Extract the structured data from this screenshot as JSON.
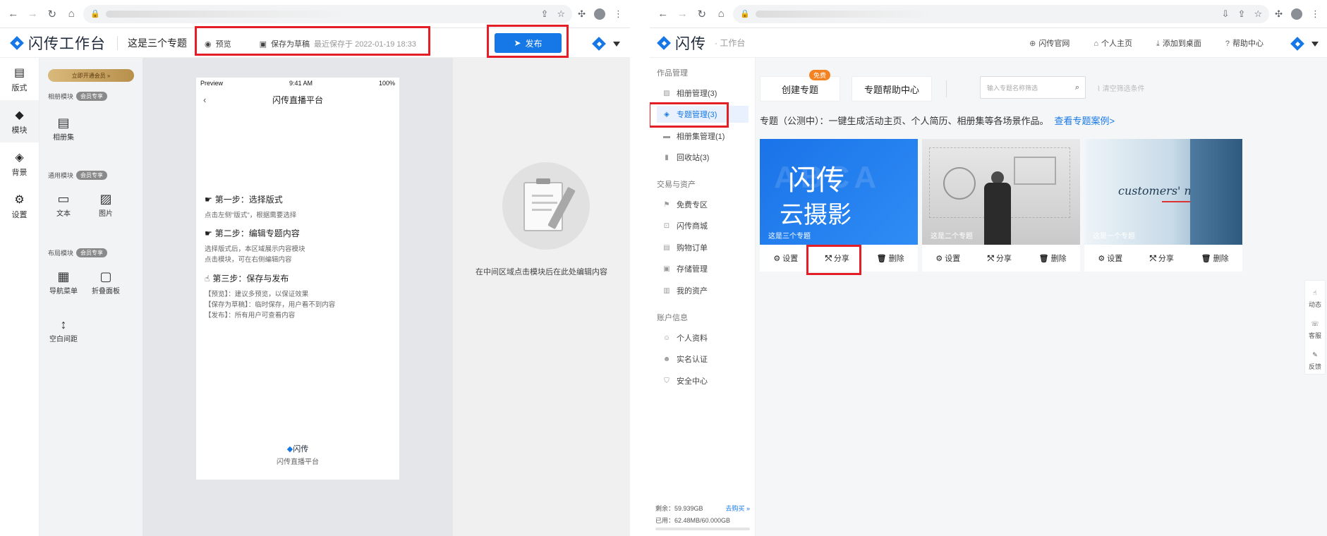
{
  "editor": {
    "logo_text": "闪传工作台",
    "page_title": "这是三个专题",
    "preview_label": "预览",
    "save_draft_label": "保存为草稿",
    "last_saved": "最近保存于 2022-01-19 18:33",
    "publish_label": "发布",
    "rail": [
      {
        "icon": "▤",
        "label": "版式"
      },
      {
        "icon": "◆",
        "label": "模块"
      },
      {
        "icon": "◈",
        "label": "背景"
      },
      {
        "icon": "⚙",
        "label": "设置"
      }
    ],
    "vip_banner": "立即开通会员 »",
    "sections": {
      "album": "相册模块",
      "general": "通用模块",
      "layout": "布局模块"
    },
    "vip_tag": "会员专享",
    "modules": {
      "album_set": "相册集",
      "text": "文本",
      "image": "图片",
      "nav_menu": "导航菜单",
      "fold_panel": "折叠面板",
      "spacer": "空白间距"
    },
    "phone": {
      "carrier": "Preview",
      "time": "9:41 AM",
      "battery": "100%",
      "header": "闪传直播平台",
      "step1_title": "第一步：选择版式",
      "step1_desc": "点击左侧\"版式\"，根据需要选择",
      "step2_title": "第二步：编辑专题内容",
      "step2_desc1": "选择版式后，本区域展示内容模块",
      "step2_desc2": "点击模块，可在右侧编辑内容",
      "step3_title": "第三步：保存与发布",
      "step3_desc1": "【预览】：建议多预览，以保证效果",
      "step3_desc2": "【保存为草稿】：临时保存，用户看不到内容",
      "step3_desc3": "【发布】：所有用户可查看内容",
      "footer_logo": "闪传",
      "footer_text": "闪传直播平台"
    },
    "right_hint": "在中间区域点击模块后在此处编辑内容"
  },
  "dashboard": {
    "logo_text": "闪传",
    "logo_sub": "· 工作台",
    "links": [
      {
        "icon": "⊕",
        "label": "闪传官网"
      },
      {
        "icon": "⌂",
        "label": "个人主页"
      },
      {
        "icon": "⤓",
        "label": "添加到桌面"
      },
      {
        "icon": "?",
        "label": "帮助中心"
      }
    ],
    "groups": {
      "works": "作品管理",
      "trade": "交易与资产",
      "account": "账户信息"
    },
    "menu": {
      "album": "相册管理(3)",
      "topics": "专题管理(3)",
      "album_sets": "相册集管理(1)",
      "recycle": "回收站(3)",
      "free": "免费专区",
      "mall": "闪传商城",
      "orders": "购物订单",
      "storage": "存储管理",
      "assets": "我的资产",
      "profile": "个人资料",
      "realname": "实名认证",
      "security": "安全中心"
    },
    "create_topic": "创建专题",
    "free_tag": "免费",
    "topic_help": "专题帮助中心",
    "search_placeholder": "输入专题名称筛选",
    "clear_filter": "清空筛选条件",
    "description": "专题（公测中）：一键生成活动主页、个人简历、相册集等各场景作品。",
    "description_link": "查看专题案例>",
    "cards": [
      {
        "label": "这是三个专题",
        "img_line1": "闪传",
        "img_line2": "云摄影"
      },
      {
        "label": "这是二个专题"
      },
      {
        "label": "这是一个专题",
        "img_text": "customers' needs"
      }
    ],
    "card_actions": {
      "settings": "设置",
      "share": "分享",
      "delete": "删除"
    },
    "storage_left": "剩余：59.939GB",
    "buy_link": "去购买 »",
    "storage_used": "已用：62.48MB/60.000GB",
    "float": {
      "dynamic": "动态",
      "service": "客服",
      "feedback": "反馈"
    }
  }
}
